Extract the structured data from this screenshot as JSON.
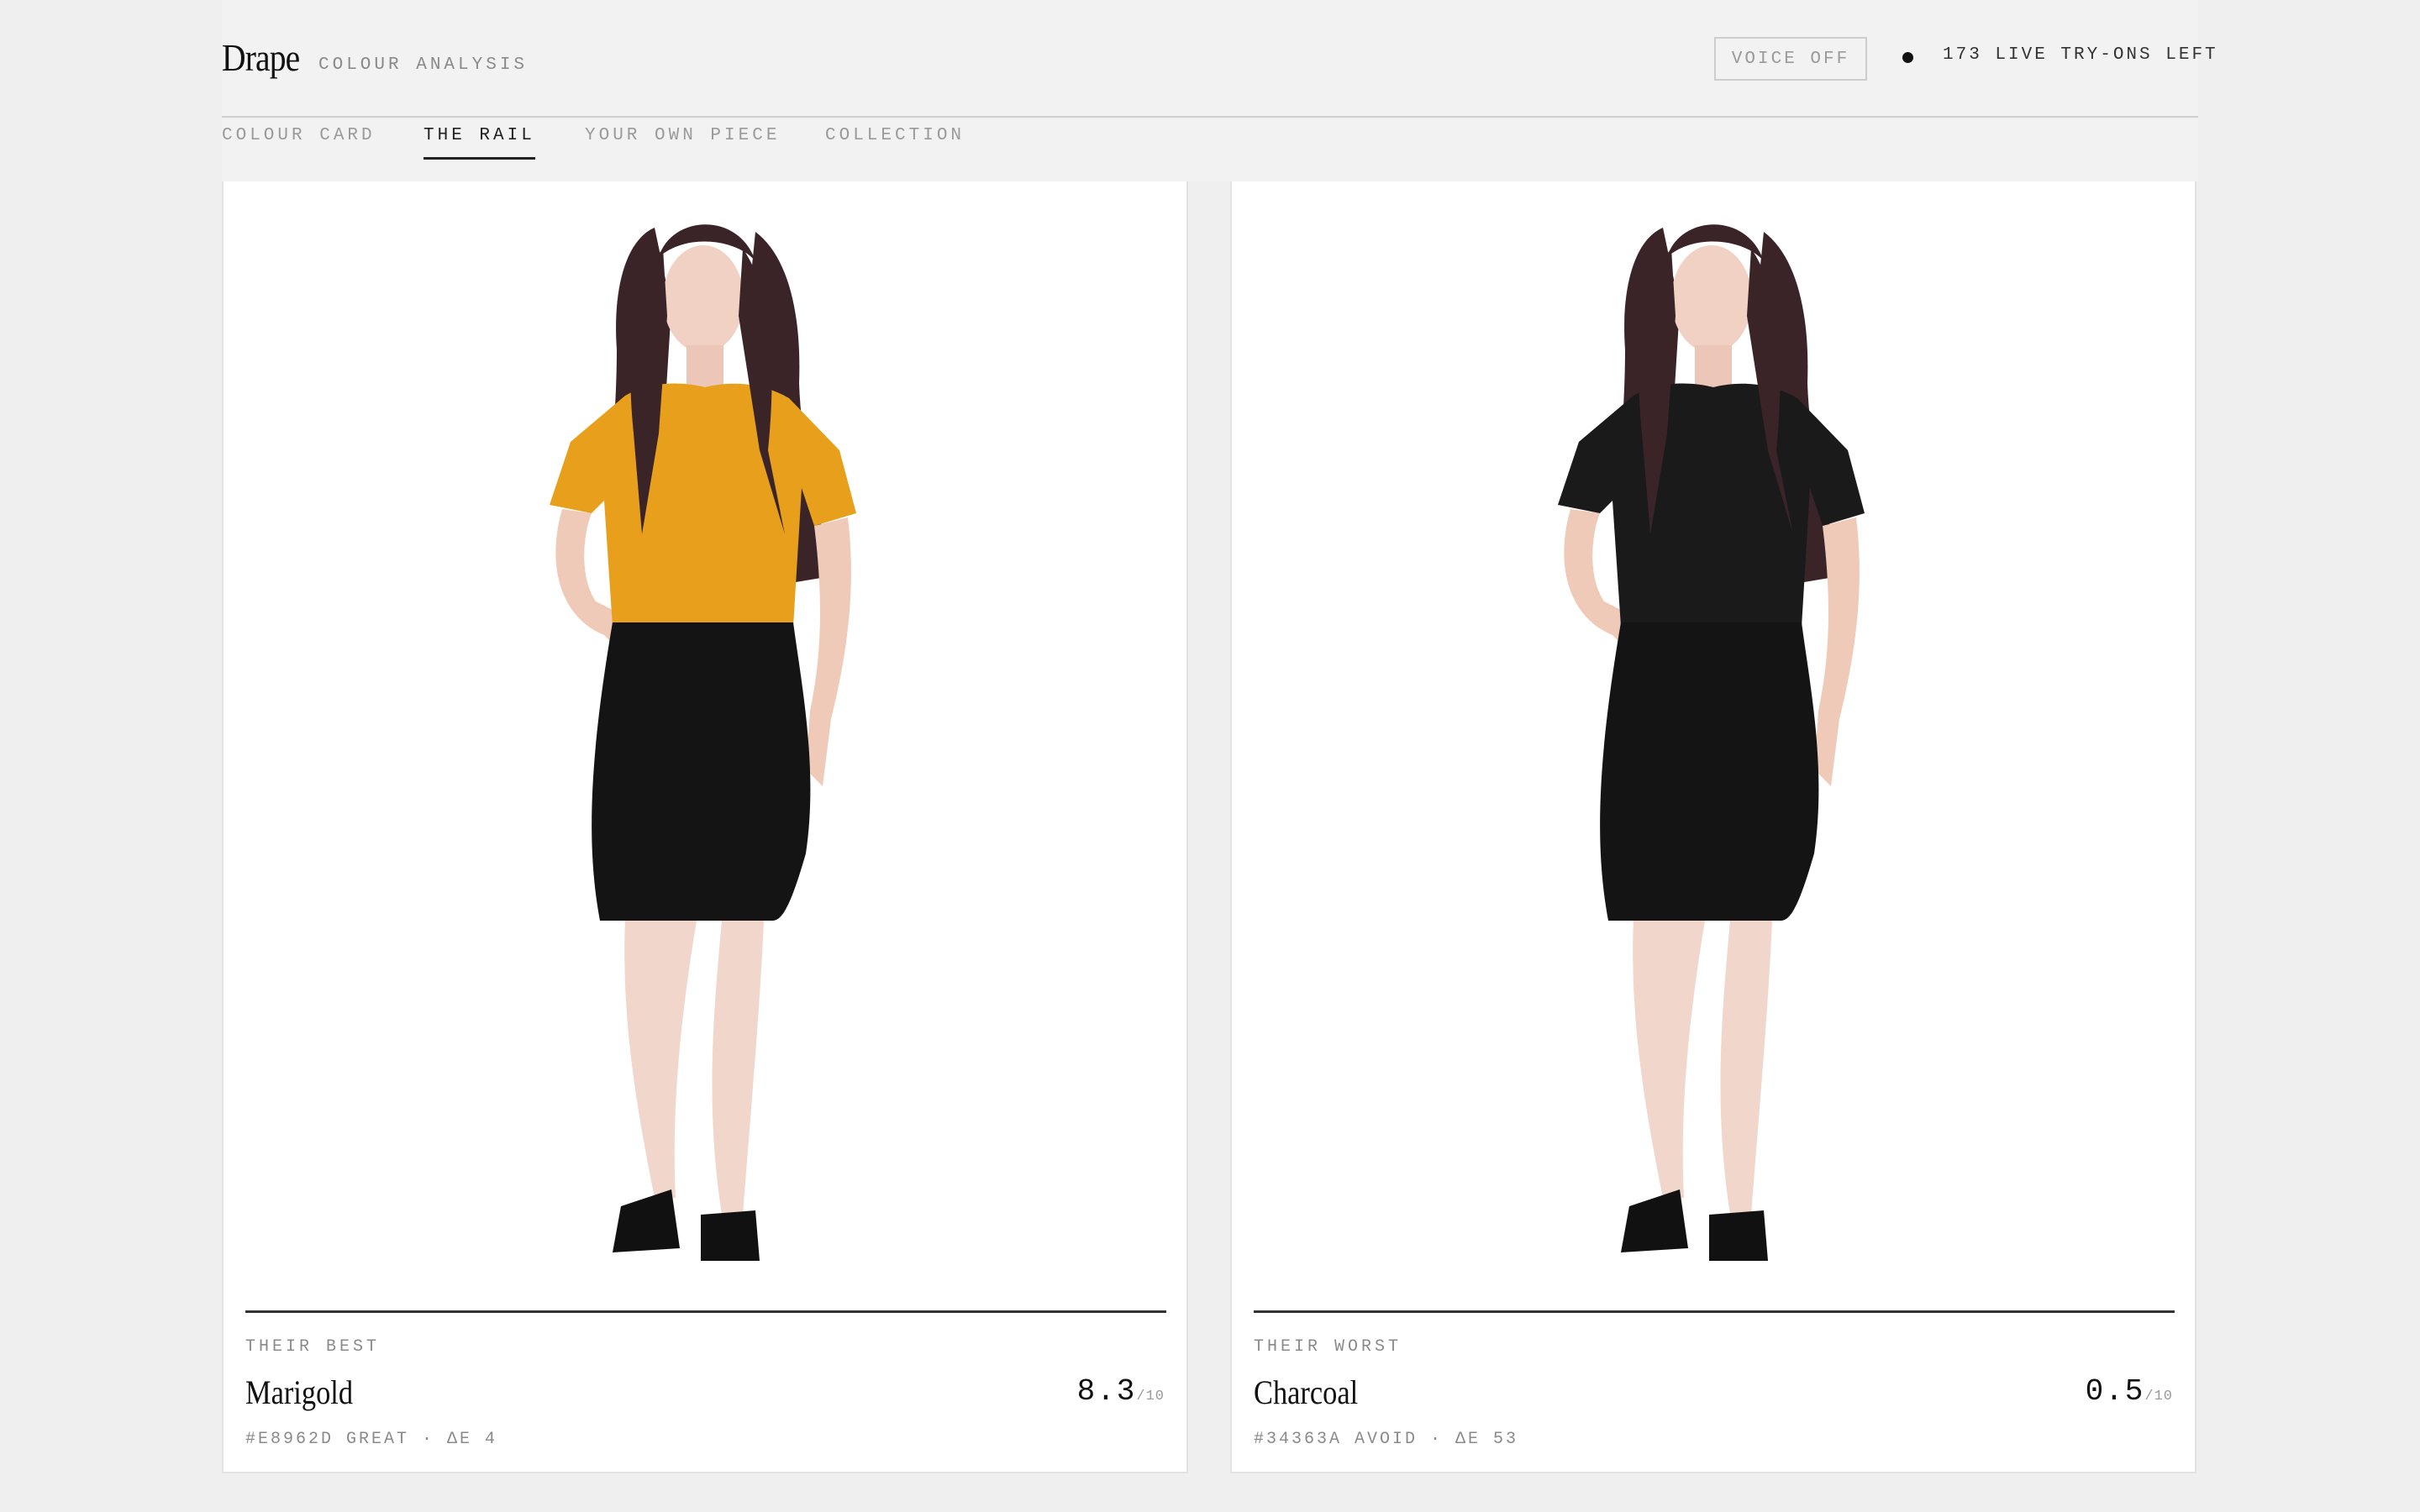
{
  "header": {
    "brand": "Drape",
    "subtitle": "COLOUR ANALYSIS",
    "voice_button": "VOICE OFF",
    "status_text": "173 LIVE TRY-ONS LEFT"
  },
  "tabs": [
    {
      "label": "COLOUR CARD",
      "active": false
    },
    {
      "label": "THE RAIL",
      "active": true
    },
    {
      "label": "YOUR OWN PIECE",
      "active": false
    },
    {
      "label": "COLLECTION",
      "active": false
    }
  ],
  "cards": [
    {
      "label": "THEIR BEST",
      "colour_name": "Marigold",
      "score": "8.3",
      "score_denominator": "/10",
      "meta": "#E8962D GREAT · ΔE 4",
      "top_colour": "#E8A01C"
    },
    {
      "label": "THEIR WORST",
      "colour_name": "Charcoal",
      "score": "0.5",
      "score_denominator": "/10",
      "meta": "#34363A AVOID · ΔE 53",
      "top_colour": "#1A1A1A"
    }
  ],
  "colors": {
    "background": "#EFEFEF",
    "card": "#FFFFFF",
    "ink": "#111111",
    "muted": "#8A8A8A"
  }
}
